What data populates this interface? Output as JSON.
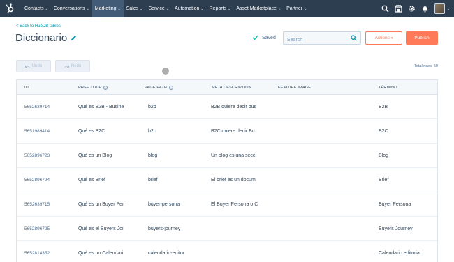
{
  "nav": {
    "items": [
      {
        "label": "Contacts",
        "active": false
      },
      {
        "label": "Conversations",
        "active": false
      },
      {
        "label": "Marketing",
        "active": true
      },
      {
        "label": "Sales",
        "active": false
      },
      {
        "label": "Service",
        "active": false
      },
      {
        "label": "Automation",
        "active": false
      },
      {
        "label": "Reports",
        "active": false
      },
      {
        "label": "Asset Marketplace",
        "active": false
      },
      {
        "label": "Partner",
        "active": false
      }
    ],
    "caret": "⌄"
  },
  "header": {
    "back_link": "< Back to HubDB tables",
    "title": "Diccionario",
    "saved_label": "Saved",
    "search_placeholder": "Search",
    "actions_label": "Actions",
    "actions_caret": "▾",
    "publish_label": "Publish"
  },
  "toolbar": {
    "undo_label": "Undo",
    "redo_label": "Redo",
    "total_rows": "Total rows: 50"
  },
  "table": {
    "columns": [
      "ID",
      "PAGE TITLE",
      "PAGE PATH",
      "META DESCRIPTION",
      "FEATURE IMAGE",
      "TÉRMINO"
    ],
    "rows": [
      {
        "id": "5652639714",
        "title": "Qué es B2B - Busine",
        "path": "b2b",
        "meta": "B2B quiere decir bus",
        "image": "",
        "termino": "B2B"
      },
      {
        "id": "5651989414",
        "title": "Qué es B2C",
        "path": "b2c",
        "meta": "B2C quiere decir Bu",
        "image": "",
        "termino": "B2C"
      },
      {
        "id": "5652896723",
        "title": "Qué es un Blog",
        "path": "blog",
        "meta": "Un blog es una secc",
        "image": "",
        "termino": "Blog"
      },
      {
        "id": "5652896724",
        "title": "Qué es Brief",
        "path": "brief",
        "meta": "El brief es un docum",
        "image": "",
        "termino": "Brief"
      },
      {
        "id": "5652639715",
        "title": "Qué es un Buyer Per",
        "path": "buyer-persona",
        "meta": "El Buyer Persona o C",
        "image": "",
        "termino": "Buyer Persona"
      },
      {
        "id": "5652896725",
        "title": "Qué es el Buyers Joi",
        "path": "buyers-journey",
        "meta": "",
        "image": "",
        "termino": "Buyers Journey"
      },
      {
        "id": "5652814352",
        "title": "Qué es un Calendari",
        "path": "calendario-editor",
        "meta": "",
        "image": "",
        "termino": "Calendario editorial"
      }
    ]
  },
  "colors": {
    "nav_bg": "#2d3e50",
    "accent": "#ff7a59",
    "link": "#0091ae",
    "saved_check": "#00bda5"
  }
}
